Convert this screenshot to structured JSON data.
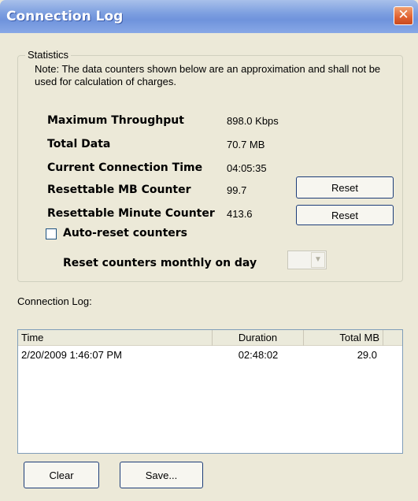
{
  "window": {
    "title": "Connection Log"
  },
  "statistics": {
    "group_label": "Statistics",
    "note": "Note: The data counters shown below are an approximation and shall not be used for calculation of charges.",
    "rows": [
      {
        "label": "Maximum Throughput",
        "value": "898.0 Kbps"
      },
      {
        "label": "Total Data",
        "value": "70.7 MB"
      },
      {
        "label": "Current Connection Time",
        "value": "04:05:35"
      },
      {
        "label": "Resettable MB Counter",
        "value": "99.7",
        "button": "Reset"
      },
      {
        "label": "Resettable Minute Counter",
        "value": "413.6",
        "button": "Reset"
      }
    ],
    "auto_reset": {
      "label": "Auto-reset counters",
      "checked": false
    },
    "monthly": {
      "label": "Reset counters monthly on day",
      "selected_day": ""
    }
  },
  "log": {
    "label": "Connection Log:",
    "columns": [
      "Time",
      "Duration",
      "Total MB"
    ],
    "rows": [
      {
        "time": "2/20/2009 1:46:07 PM",
        "duration": "02:48:02",
        "total_mb": "29.0"
      }
    ]
  },
  "actions": {
    "clear": "Clear",
    "save": "Save..."
  },
  "icons": {
    "close": "close-icon",
    "dropdown": "chevron-down-icon"
  },
  "colors": {
    "title_bar": "#7d9fe0",
    "close_button": "#e06030",
    "window_bg": "#ece9d8"
  }
}
